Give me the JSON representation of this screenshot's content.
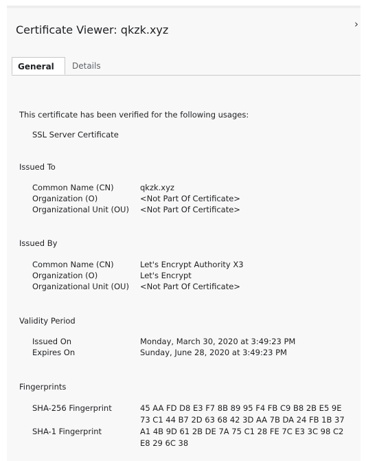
{
  "window": {
    "title": "Certificate Viewer: qkzk.xyz",
    "close_glyph": "›"
  },
  "tabs": {
    "general": "General",
    "details": "Details"
  },
  "usages": {
    "heading": "This certificate has been verified for the following usages:",
    "items": [
      "SSL Server Certificate"
    ]
  },
  "issued_to": {
    "heading": "Issued To",
    "rows": [
      {
        "label": "Common Name (CN)",
        "value": "qkzk.xyz"
      },
      {
        "label": "Organization (O)",
        "value": "<Not Part Of Certificate>"
      },
      {
        "label": "Organizational Unit (OU)",
        "value": "<Not Part Of Certificate>"
      }
    ]
  },
  "issued_by": {
    "heading": "Issued By",
    "rows": [
      {
        "label": "Common Name (CN)",
        "value": "Let's Encrypt Authority X3"
      },
      {
        "label": "Organization (O)",
        "value": "Let's Encrypt"
      },
      {
        "label": "Organizational Unit (OU)",
        "value": "<Not Part Of Certificate>"
      }
    ]
  },
  "validity": {
    "heading": "Validity Period",
    "rows": [
      {
        "label": "Issued On",
        "value": "Monday, March 30, 2020 at 3:49:23 PM"
      },
      {
        "label": "Expires On",
        "value": "Sunday, June 28, 2020 at 3:49:23 PM"
      }
    ]
  },
  "fingerprints": {
    "heading": "Fingerprints",
    "sha256": {
      "label": "SHA-256 Fingerprint",
      "line1": "45 AA FD D8 E3 F7 8B 89 95 F4 FB C9 B8 2B E5 9E",
      "line2": "73 C1 44 B7 2D 63 68 42 3D AA 7B DA 24 FB 1B 37"
    },
    "sha1": {
      "label": "SHA-1 Fingerprint",
      "line1": "A1 4B 9D 61 2B DE 7A 75 C1 28 FE 7C E3 3C 98 C2",
      "line2": "E8 29 6C 38"
    }
  }
}
